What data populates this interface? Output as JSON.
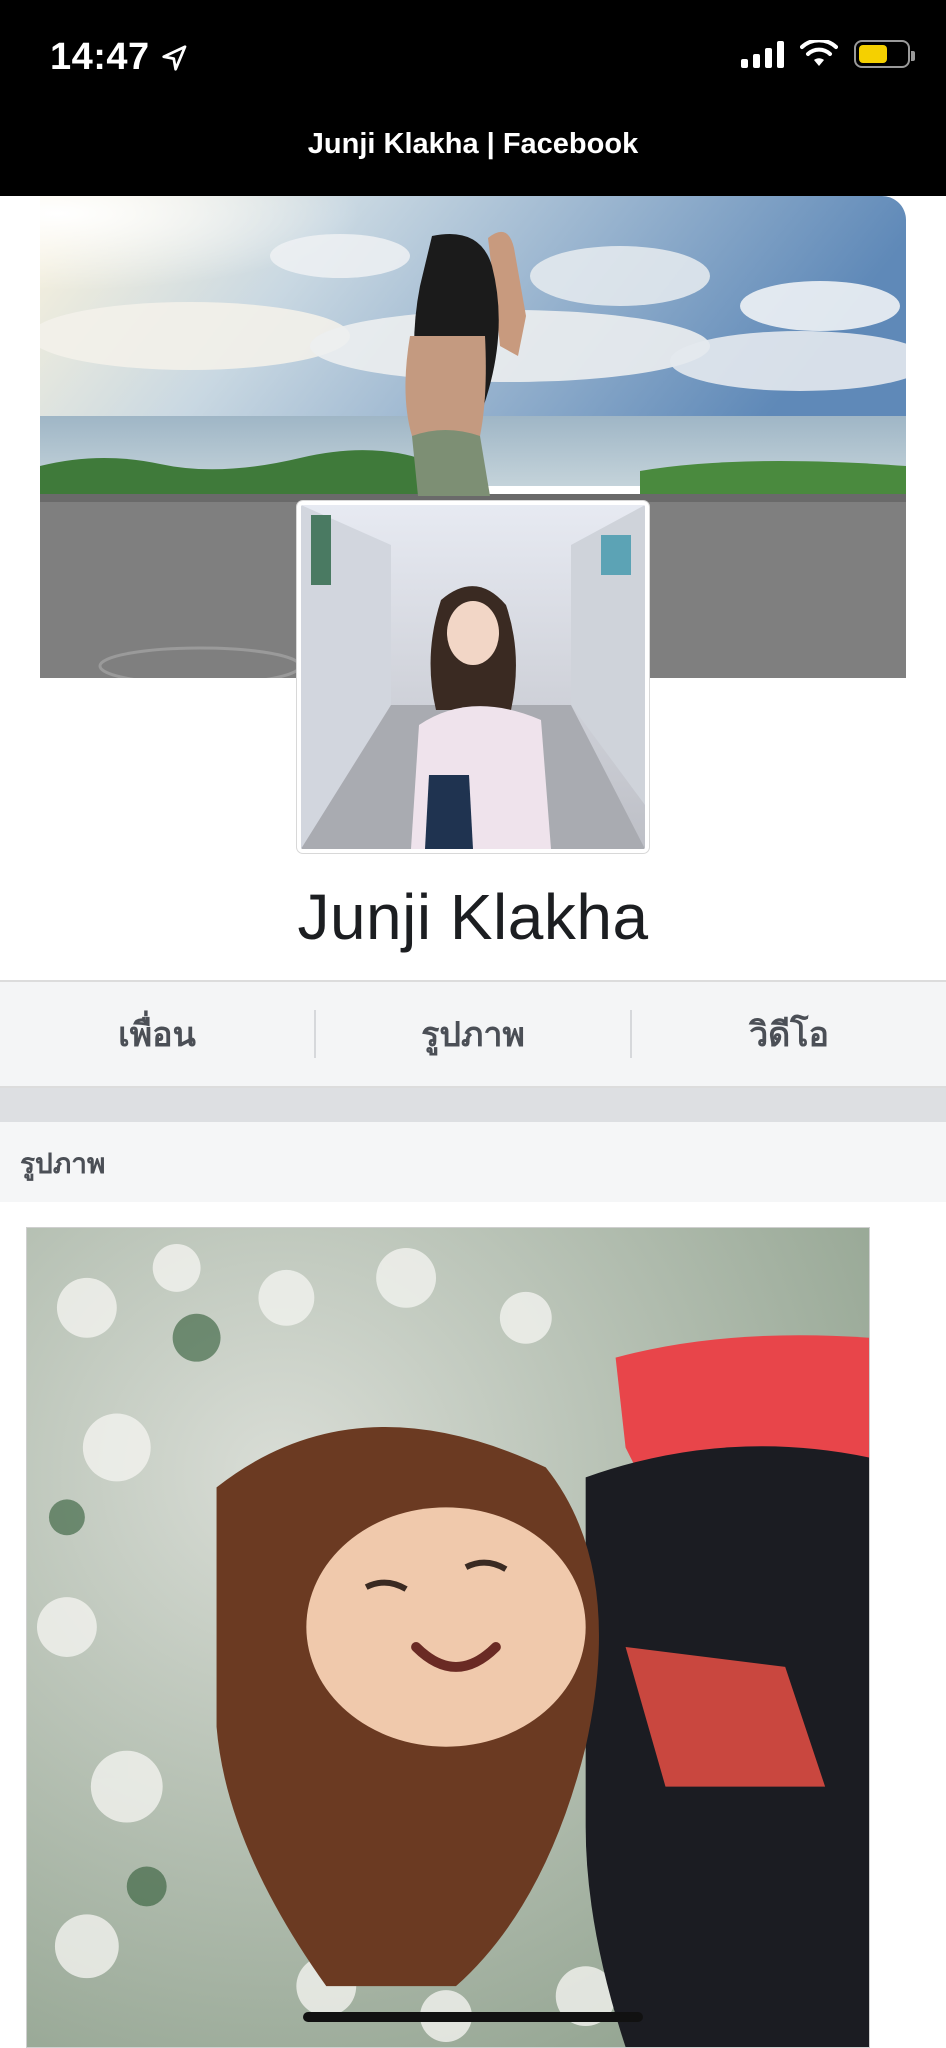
{
  "status_bar": {
    "time": "14:47",
    "battery_level": 0.6,
    "battery_color": "#f5d000"
  },
  "page": {
    "title": "Junji Klakha | Facebook"
  },
  "profile": {
    "name": "Junji Klakha"
  },
  "tabs": [
    {
      "label": "เพื่อน"
    },
    {
      "label": "รูปภาพ"
    },
    {
      "label": "วิดีโอ"
    }
  ],
  "photos_section": {
    "title": "รูปภาพ"
  },
  "colors": {
    "header_bg": "#000000",
    "tab_bg": "#f4f5f6",
    "text_dark": "#1c1e21",
    "text_secondary": "#4b4f56"
  }
}
